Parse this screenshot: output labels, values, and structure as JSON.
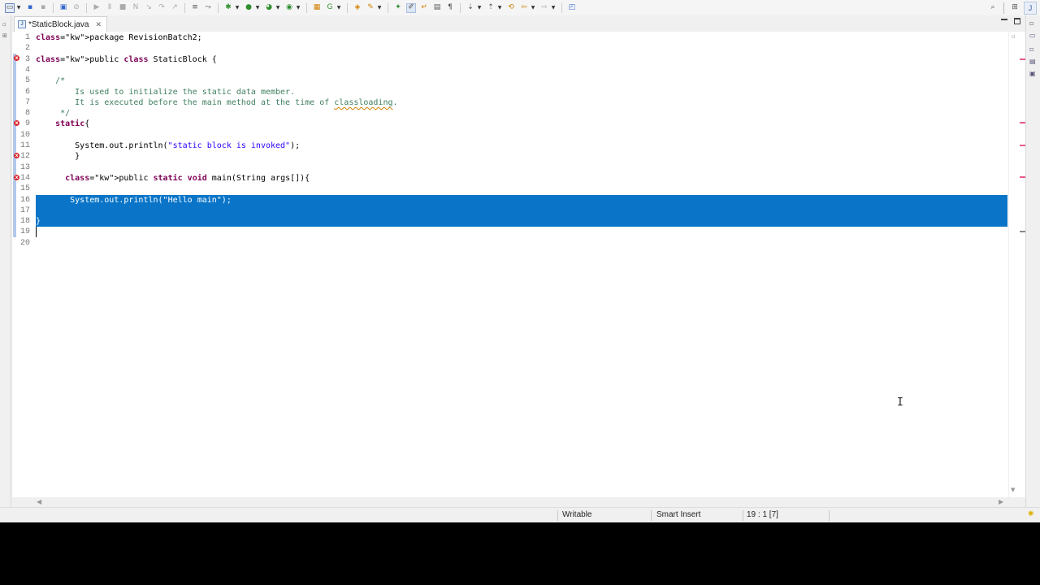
{
  "editor_tab": {
    "title": "*StaticBlock.java",
    "close": "✕"
  },
  "code": {
    "lines": [
      "package RevisionBatch2;",
      "",
      "public class StaticBlock {",
      "",
      "    /*",
      "        Is used to initialize the static data member.",
      "        It is executed before the main method at the time of classloading.",
      "     */",
      "    static{",
      "",
      "        System.out.println(\"static block is invoked\");",
      "        }",
      "",
      "      public static void main(String args[]){",
      "",
      "       System.out.println(\"Hello main\");",
      "",
      "}",
      "",
      ""
    ],
    "line_numbers": [
      "1",
      "2",
      "3",
      "4",
      "5",
      "6",
      "7",
      "8",
      "9",
      "10",
      "11",
      "12",
      "13",
      "14",
      "15",
      "16",
      "17",
      "18",
      "19",
      "20"
    ]
  },
  "status": {
    "writable": "Writable",
    "insert_mode": "Smart Insert",
    "position": "19 : 1 [7]"
  },
  "icons": {
    "error_marker": "error-marker-icon",
    "lightbulb": "lightbulb-icon",
    "search": "search-icon"
  },
  "colors": {
    "selection": "#0a75c8",
    "keyword": "#7f0055",
    "comment": "#3f7f5f",
    "string": "#2a00ff",
    "error": "#d8232a"
  }
}
